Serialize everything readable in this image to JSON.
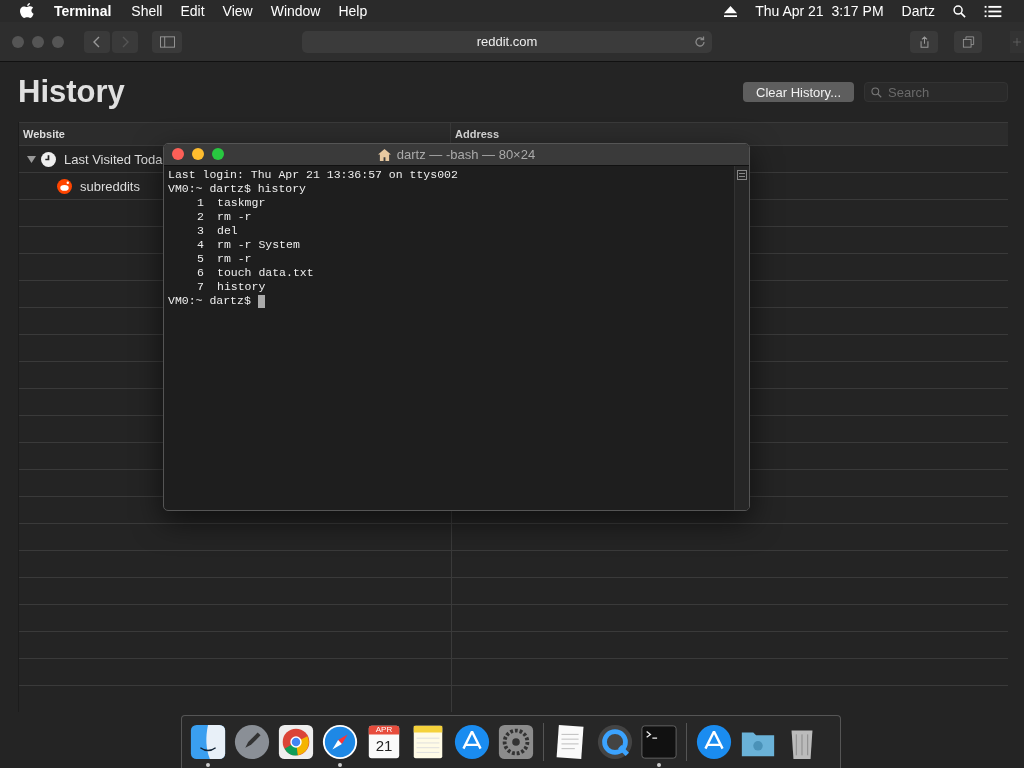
{
  "menu_bar": {
    "app": "Terminal",
    "items": [
      "Shell",
      "Edit",
      "View",
      "Window",
      "Help"
    ],
    "clock": "Thu Apr 21  3:17 PM",
    "user": "Dartz"
  },
  "browser": {
    "address": "reddit.com",
    "title": "History",
    "clear_button": "Clear History...",
    "search": {
      "placeholder": "Search"
    },
    "table": {
      "columns": [
        "Website",
        "Address"
      ],
      "groups": [
        {
          "label": "Last Visited Toda",
          "expanded": true,
          "children": [
            {
              "label": "subreddits"
            }
          ]
        }
      ]
    }
  },
  "terminal": {
    "title": "dartz — -bash — 80×24",
    "login": "Last login: Thu Apr 21 13:36:57 on ttys002",
    "prompt": "VM0:~ dartz$",
    "command": "history",
    "history": [
      {
        "number": "1",
        "command": "taskmgr"
      },
      {
        "number": "2",
        "command": "rm -r"
      },
      {
        "number": "3",
        "command": "del"
      },
      {
        "number": "4",
        "command": "rm -r System"
      },
      {
        "number": "5",
        "command": "rm -r"
      },
      {
        "number": "6",
        "command": "touch data.txt"
      },
      {
        "number": "7",
        "command": "history"
      }
    ],
    "final_prompt": "VM0:~ dartz$"
  },
  "dock": [
    {
      "kind": "finder",
      "running": true
    },
    {
      "kind": "launchpad",
      "running": false
    },
    {
      "kind": "chrome",
      "running": false
    },
    {
      "kind": "safari",
      "running": true
    },
    {
      "kind": "calendar",
      "running": false,
      "month": "APR",
      "day": "21"
    },
    {
      "kind": "notes",
      "running": false
    },
    {
      "kind": "appstore",
      "running": false
    },
    {
      "kind": "preferences",
      "running": false
    },
    {
      "kind": "separator"
    },
    {
      "kind": "textedit",
      "running": false
    },
    {
      "kind": "quicktime",
      "running": false
    },
    {
      "kind": "terminal",
      "running": true
    },
    {
      "kind": "separator"
    },
    {
      "kind": "download",
      "running": false
    },
    {
      "kind": "folder",
      "running": false
    },
    {
      "kind": "trash",
      "running": false
    }
  ]
}
